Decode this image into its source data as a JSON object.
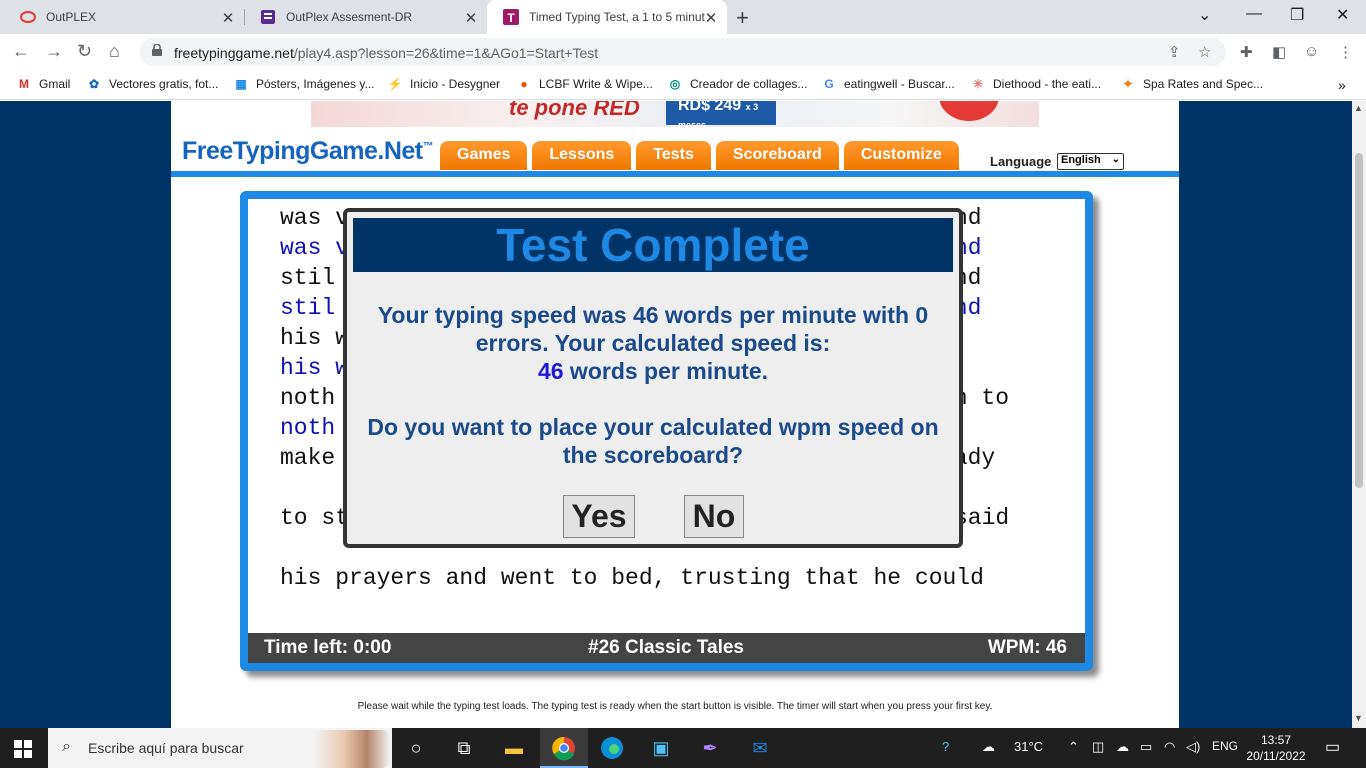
{
  "browser": {
    "tabs": [
      {
        "title": "OutPLEX",
        "active": false
      },
      {
        "title": "OutPlex Assesment-DR",
        "active": false
      },
      {
        "title": "Timed Typing Test, a 1 to 5 minut",
        "active": true
      }
    ],
    "close_glyph": "✕",
    "new_tab_glyph": "+",
    "url_host": "freetypinggame.net",
    "url_path": "/play4.asp?lesson=26&time=1&AGo1=Start+Test",
    "bookmarks": [
      {
        "label": "Gmail",
        "icon": "M",
        "color": "#d93025"
      },
      {
        "label": "Vectores gratis, fot...",
        "icon": "✿",
        "color": "#1565c0"
      },
      {
        "label": "Pósters, Imágenes y...",
        "icon": "▦",
        "color": "#1e88e5"
      },
      {
        "label": "Inicio - Desygner",
        "icon": "⚡",
        "color": "#7b1fa2"
      },
      {
        "label": "LCBF Write & Wipe...",
        "icon": "●",
        "color": "#e65100"
      },
      {
        "label": "Creador de collages...",
        "icon": "◎",
        "color": "#00897b"
      },
      {
        "label": "eatingwell - Buscar...",
        "icon": "G",
        "color": "#4285f4"
      },
      {
        "label": "Diethood - the eati...",
        "icon": "✳",
        "color": "#e57373"
      },
      {
        "label": "Spa Rates and Spec...",
        "icon": "✦",
        "color": "#f57c00"
      }
    ],
    "bookmarks_more": "»"
  },
  "site": {
    "ad_text": "te pone RED",
    "ad_price": "RD$ 249",
    "ad_price_note": "x 3 meses",
    "logo": "FreeTypingGame.Net",
    "logo_tm": "™",
    "menu": [
      "Games",
      "Lessons",
      "Tests",
      "Scoreboard",
      "Customize"
    ],
    "language_label": "Language",
    "language_value": "English",
    "footer_note": "Please wait while the typing test loads. The typing test is ready when the start button is visible. The timer will start when you press your first key."
  },
  "typing_test": {
    "lines": [
      {
        "left": "was v",
        "right": "nd",
        "typed": false
      },
      {
        "left": "was v",
        "right": "nd",
        "typed": true
      },
      {
        "left": "stil",
        "right": "and",
        "typed": false
      },
      {
        "left": "stil",
        "right": "and",
        "typed": true
      },
      {
        "left": "his w",
        "right": "",
        "typed": false
      },
      {
        "left": "his w",
        "right": "",
        "typed": true
      },
      {
        "left": "noth",
        "right": "gh to",
        "typed": false
      },
      {
        "left": "noth",
        "right": "",
        "typed": true
      },
      {
        "left": "make",
        "right": "eady",
        "typed": false
      },
      {
        "left": "",
        "right": "",
        "typed": false
      },
      {
        "left": "to st",
        "right": "said",
        "typed": false
      },
      {
        "left": "",
        "right": "",
        "typed": false
      },
      {
        "left": "his prayers and went to bed, trusting that he could",
        "right": "",
        "typed": false
      }
    ],
    "status": {
      "time_left": "Time left: 0:00",
      "lesson": "#26 Classic Tales",
      "wpm": "WPM: 46"
    }
  },
  "modal": {
    "title": "Test Complete",
    "message_line1": "Your typing speed was 46 words per minute with 0",
    "message_line2": "errors. Your calculated speed is:",
    "speed_value": "46",
    "speed_unit": " words per minute.",
    "question_line1": "Do you want to place your calculated wpm speed on",
    "question_line2": "the scoreboard?",
    "yes_label": "Yes",
    "no_label": "No"
  },
  "taskbar": {
    "search_placeholder": "Escribe aquí para buscar",
    "weather": "31°C",
    "language": "ENG",
    "time": "13:57",
    "date": "20/11/2022"
  },
  "colors": {
    "page_bg": "#003366",
    "accent_blue": "#1e88e5",
    "menu_orange": "#f07800",
    "typed_text": "#1010b8"
  }
}
